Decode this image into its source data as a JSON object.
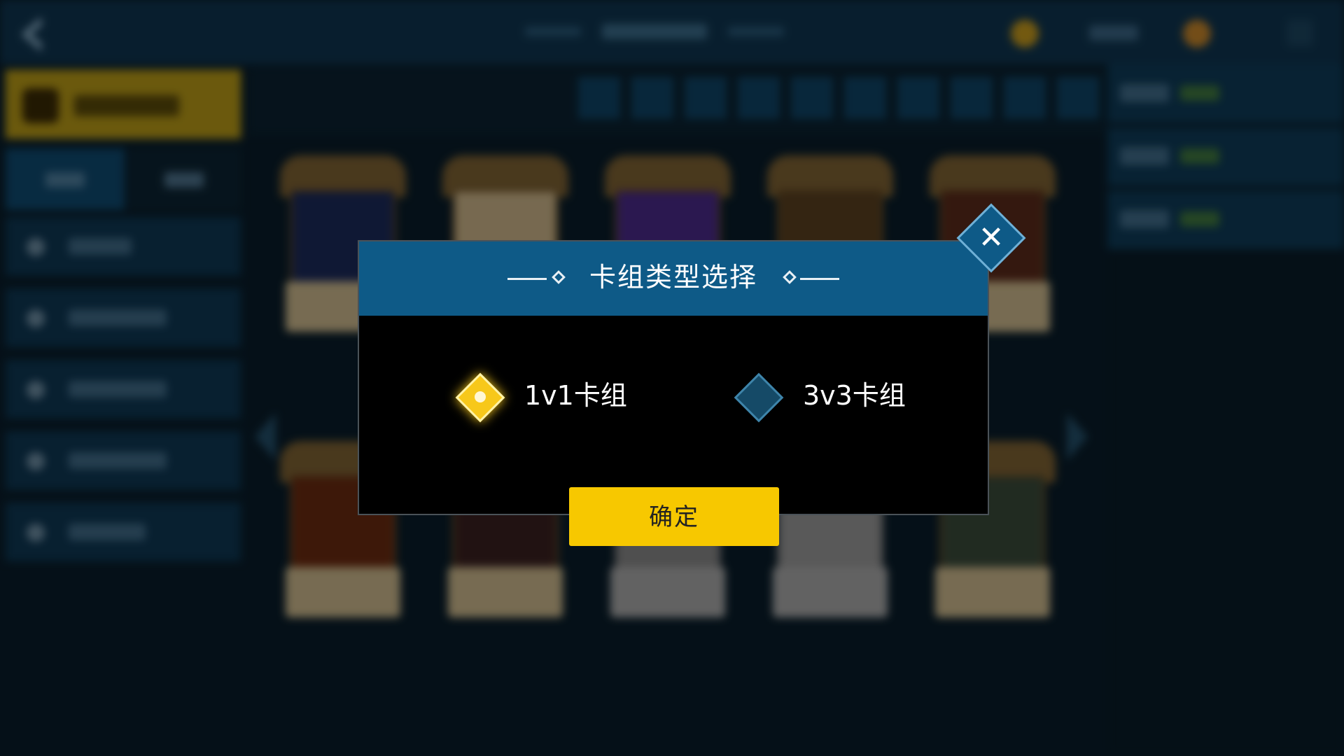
{
  "modal": {
    "title": "卡组类型选择",
    "options": [
      {
        "label": "1v1卡组",
        "selected": true
      },
      {
        "label": "3v3卡组",
        "selected": false
      }
    ],
    "confirm_label": "确定",
    "close_icon": "✕"
  },
  "colors": {
    "header_blue": "#0e5a87",
    "confirm_yellow": "#f7c800",
    "selected_gold": "#f7c81a",
    "background_navy": "#0a1d2a"
  },
  "icons": [
    "back-arrow-icon",
    "coin-icon",
    "gem-icon",
    "menu-icon",
    "deck-icon",
    "close-icon",
    "diamond-radio-icon",
    "chevron-left-icon",
    "chevron-right-icon"
  ]
}
